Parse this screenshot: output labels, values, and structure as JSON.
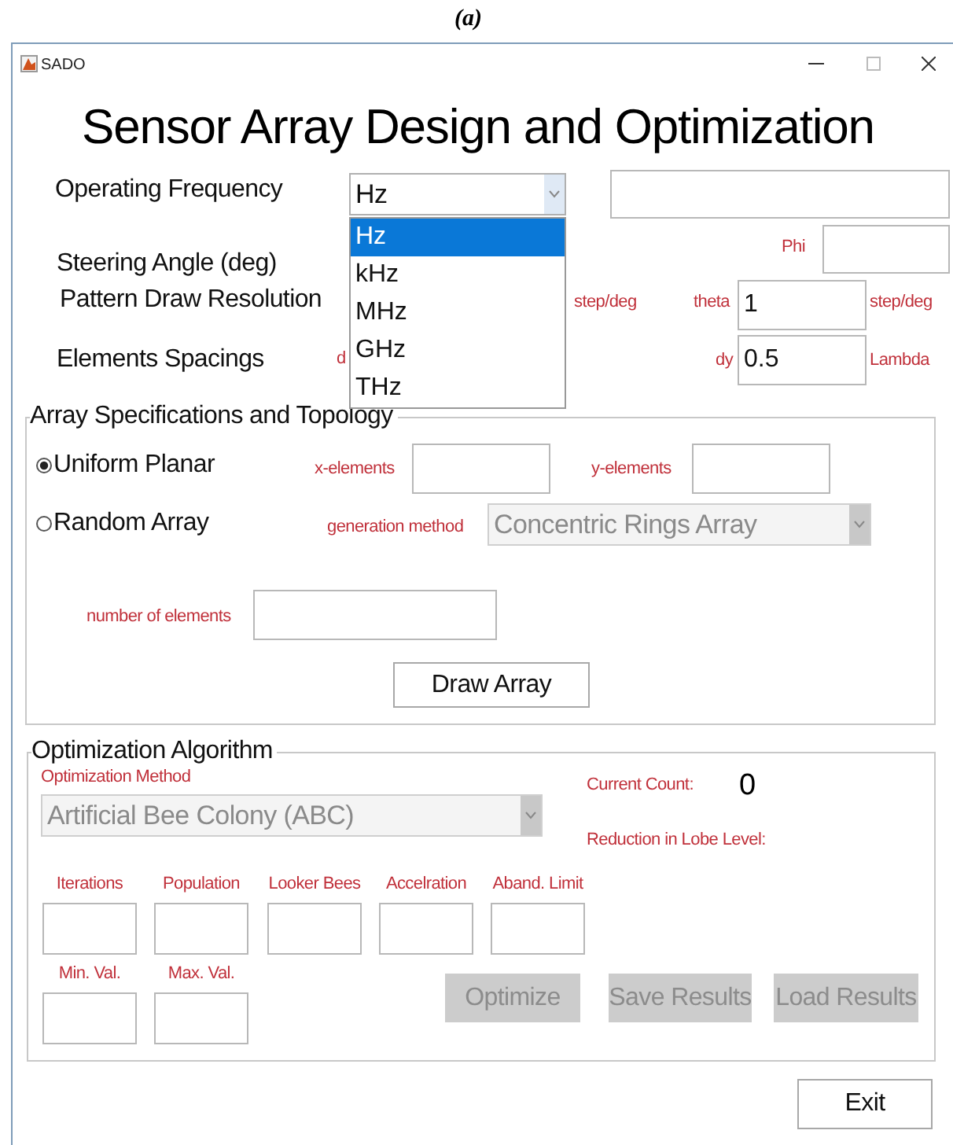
{
  "caption": "(a)",
  "window": {
    "title": "SADO"
  },
  "heading": "Sensor Array Design and Optimization",
  "settings": {
    "frequency_label": "Operating Frequency",
    "unit_dropdown": {
      "value": "Hz",
      "expanded": true,
      "options": [
        {
          "label": "Hz",
          "selected": true
        },
        {
          "label": "kHz",
          "selected": false
        },
        {
          "label": "MHz",
          "selected": false
        },
        {
          "label": "GHz",
          "selected": false
        },
        {
          "label": "THz",
          "selected": false
        }
      ]
    },
    "steering_label": "Steering Angle (deg)",
    "phi_label": "Phi",
    "resolution_label": "Pattern Draw Resolution",
    "resolution_unit_1": "step/deg",
    "theta_label": "theta",
    "theta_value": "1",
    "resolution_unit_2": "step/deg",
    "spacing_label": "Elements Spacings",
    "dx_label_partial": "d",
    "dy_label": "dy",
    "dy_value": "0.5",
    "spacing_unit": "Lambda"
  },
  "array_panel": {
    "title": "Array Specifications and Topology",
    "radios": [
      {
        "label": "Uniform Planar",
        "selected": true
      },
      {
        "label": "Random Array",
        "selected": false
      }
    ],
    "x_elements_label": "x-elements",
    "y_elements_label": "y-elements",
    "generation_label": "generation method",
    "generation_dropdown": {
      "value": "Concentric Rings Array",
      "disabled": true
    },
    "number_label": "number of elements",
    "draw_button": {
      "label": "Draw Array",
      "disabled": false
    }
  },
  "optimization_panel": {
    "title": "Optimization Algorithm",
    "method_label": "Optimization Method",
    "method_dropdown": {
      "value": "Artificial Bee Colony (ABC)",
      "disabled": true
    },
    "count_label": "Current Count:",
    "count_value": "0",
    "reduction_label": "Reduction in Lobe Level:",
    "parameters": [
      {
        "label": "Iterations"
      },
      {
        "label": "Population"
      },
      {
        "label": "Looker Bees"
      },
      {
        "label": "Accelration"
      },
      {
        "label": "Aband. Limit"
      },
      {
        "label": "Min. Val."
      },
      {
        "label": "Max. Val."
      }
    ],
    "buttons": [
      {
        "label": "Optimize",
        "disabled": true
      },
      {
        "label": "Save Results",
        "disabled": true
      },
      {
        "label": "Load Results",
        "disabled": true
      }
    ]
  },
  "exit_button": {
    "label": "Exit",
    "disabled": false
  }
}
